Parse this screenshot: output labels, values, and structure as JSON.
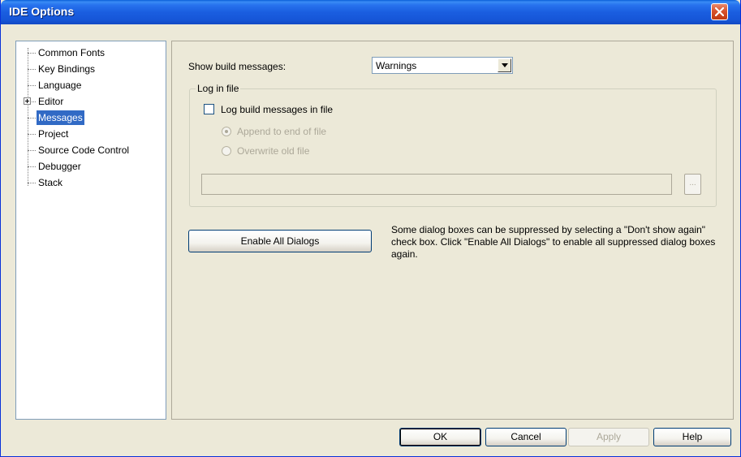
{
  "window": {
    "title": "IDE Options"
  },
  "tree": {
    "items": [
      {
        "label": "Common Fonts",
        "selected": false,
        "expandable": false
      },
      {
        "label": "Key Bindings",
        "selected": false,
        "expandable": false
      },
      {
        "label": "Language",
        "selected": false,
        "expandable": false
      },
      {
        "label": "Editor",
        "selected": false,
        "expandable": true
      },
      {
        "label": "Messages",
        "selected": true,
        "expandable": false
      },
      {
        "label": "Project",
        "selected": false,
        "expandable": false
      },
      {
        "label": "Source Code Control",
        "selected": false,
        "expandable": false
      },
      {
        "label": "Debugger",
        "selected": false,
        "expandable": false
      },
      {
        "label": "Stack",
        "selected": false,
        "expandable": false
      }
    ]
  },
  "messages_panel": {
    "show_build_label": "Show build messages:",
    "show_build_value": "Warnings",
    "log_group_title": "Log in file",
    "log_checkbox_label": "Log build messages in file",
    "log_checkbox_checked": false,
    "radio_append_label": "Append to end of file",
    "radio_overwrite_label": "Overwrite old file",
    "browse_label": "...",
    "enable_dialogs_label": "Enable All Dialogs",
    "description": "Some dialog boxes can be suppressed by selecting a \"Don't show again\" check box. Click \"Enable All Dialogs\" to enable all suppressed dialog boxes again."
  },
  "buttons": {
    "ok": "OK",
    "cancel": "Cancel",
    "apply": "Apply",
    "help": "Help"
  }
}
